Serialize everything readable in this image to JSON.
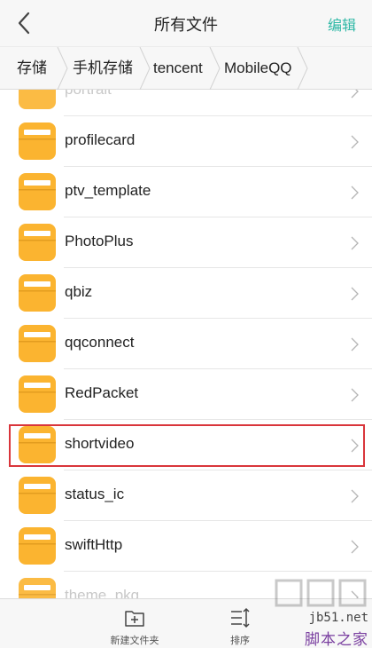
{
  "header": {
    "title": "所有文件",
    "edit_label": "编辑"
  },
  "breadcrumb": [
    "存储",
    "手机存储",
    "tencent",
    "MobileQQ"
  ],
  "files": [
    {
      "name": "portrait"
    },
    {
      "name": "profilecard"
    },
    {
      "name": "ptv_template"
    },
    {
      "name": "PhotoPlus"
    },
    {
      "name": "qbiz"
    },
    {
      "name": "qqconnect"
    },
    {
      "name": "RedPacket"
    },
    {
      "name": "shortvideo",
      "highlighted": true
    },
    {
      "name": "status_ic"
    },
    {
      "name": "swiftHttp"
    },
    {
      "name": "theme_pkg"
    }
  ],
  "toolbar": {
    "new_folder_label": "新建文件夹",
    "sort_label": "排序"
  },
  "watermark": {
    "site": "jb51.net",
    "name": "脚本之家"
  },
  "colors": {
    "accent": "#2fb8a6",
    "folder": "#fbb430",
    "highlight_border": "#d9353b"
  }
}
